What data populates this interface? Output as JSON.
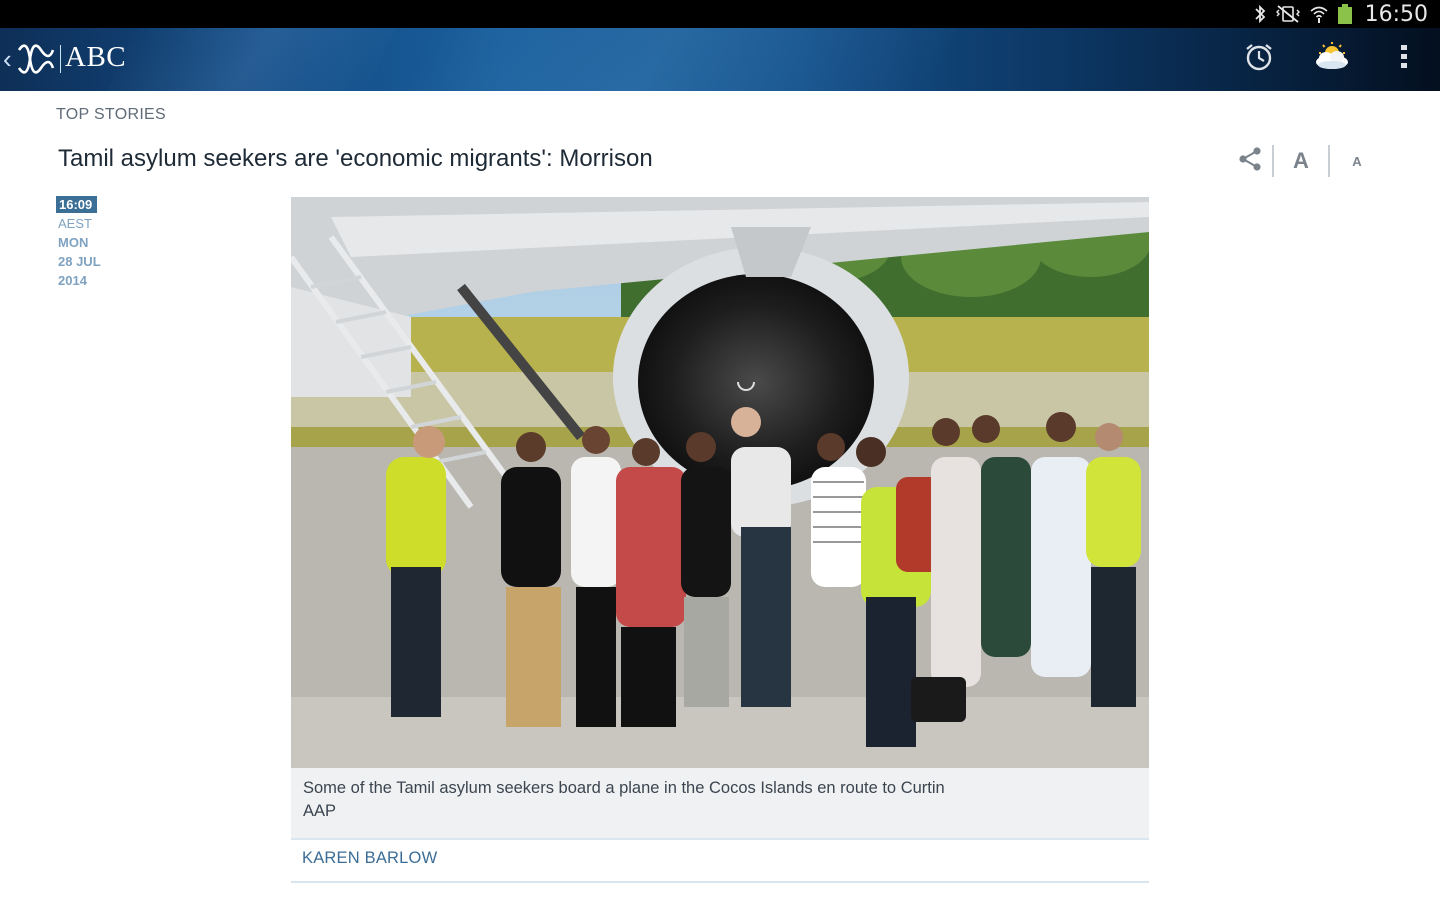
{
  "status_bar": {
    "time": "16:50",
    "icons": [
      "bluetooth-icon",
      "vibrate-mute-icon",
      "wifi-icon",
      "battery-icon"
    ]
  },
  "app_bar": {
    "title": "ABC",
    "back_glyph": "‹",
    "actions": [
      "alarm-icon",
      "weather-icon",
      "overflow-menu-icon"
    ],
    "colors": {
      "bar_dark": "#0e2f57",
      "bar_light": "#1a5f9c"
    }
  },
  "article": {
    "section": "TOP STORIES",
    "headline": "Tamil asylum seekers are 'economic migrants': Morrison",
    "tools": {
      "share": "share-icon",
      "font_large": "A",
      "font_small": "A"
    },
    "dateline": {
      "time": "16:09",
      "timezone": "AEST",
      "day": "MON",
      "date": "28 JUL",
      "year": "2014"
    },
    "photo": {
      "caption": "Some of the Tamil asylum seekers board a plane in the Cocos Islands en route to Curtin",
      "credit": "AAP"
    },
    "byline": "KAREN BARLOW"
  },
  "colors": {
    "accent": "#3c6f96",
    "date_text": "#7fa2c0",
    "byline": "#3b6d96"
  }
}
